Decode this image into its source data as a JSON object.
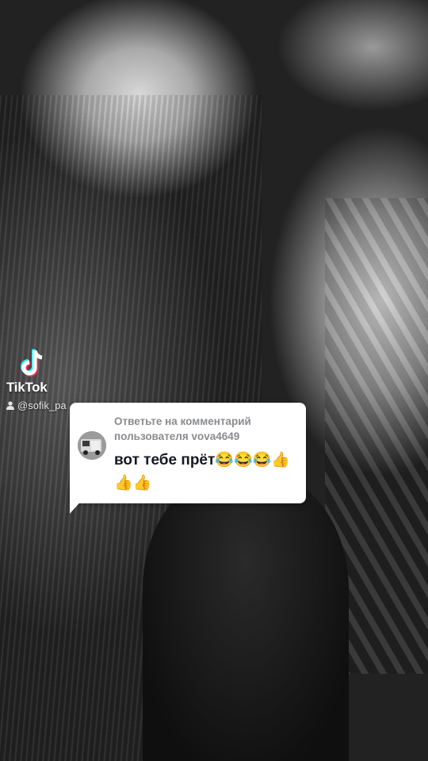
{
  "watermark": {
    "brand": "TikTok",
    "handle": "@sofik_pa"
  },
  "reply_card": {
    "header": "Ответьте на комментарий пользователя vova4649",
    "comment": "вот тебе прёт😂😂😂👍👍👍"
  },
  "colors": {
    "card_background": "#ffffff",
    "header_text": "#8a8b91",
    "comment_text": "#161823",
    "tiktok_cyan": "#25f4ee",
    "tiktok_red": "#fe2c55"
  },
  "icons": [
    "tiktok-logo-icon",
    "user-icon",
    "commenter-avatar"
  ]
}
